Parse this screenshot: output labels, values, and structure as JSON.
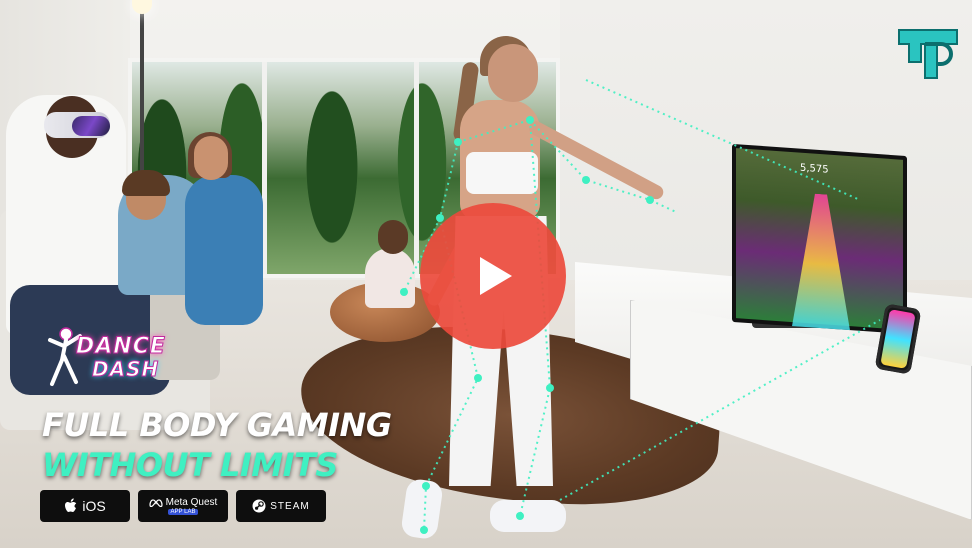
{
  "overlay": {
    "brand_icon": "tp-logo-icon",
    "game_logo": {
      "line1": "DANCE",
      "line2": "DASH"
    },
    "headline_line1": "FULL BODY GAMING",
    "headline_line2": "WITHOUT LIMITS",
    "play_icon": "play-icon",
    "accent_color": "#3ff0c2",
    "play_color": "#eb4a3c"
  },
  "platforms": [
    {
      "icon": "apple-icon",
      "label": "iOS"
    },
    {
      "icon": "meta-icon",
      "label": "Meta Quest",
      "sub": "APP LAB"
    },
    {
      "icon": "steam-icon",
      "label": "STEAM"
    }
  ],
  "tv": {
    "score": "5,575"
  }
}
